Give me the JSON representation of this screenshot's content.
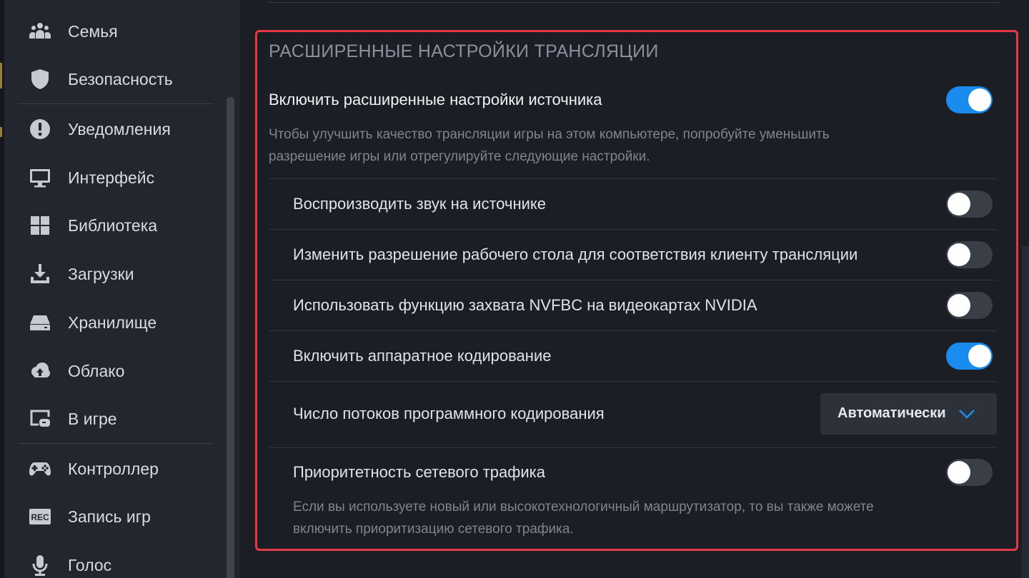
{
  "sidebar": {
    "items": [
      {
        "label": "Семья",
        "icon": "family-icon"
      },
      {
        "label": "Безопасность",
        "icon": "shield-icon"
      },
      {
        "label": "Уведомления",
        "icon": "alert-icon"
      },
      {
        "label": "Интерфейс",
        "icon": "monitor-icon"
      },
      {
        "label": "Библиотека",
        "icon": "grid-icon"
      },
      {
        "label": "Загрузки",
        "icon": "download-icon"
      },
      {
        "label": "Хранилище",
        "icon": "drive-icon"
      },
      {
        "label": "Облако",
        "icon": "cloud-icon"
      },
      {
        "label": "В игре",
        "icon": "ingame-icon"
      },
      {
        "label": "Контроллер",
        "icon": "gamepad-icon"
      },
      {
        "label": "Запись игр",
        "icon": "rec-icon"
      },
      {
        "label": "Голос",
        "icon": "microphone-icon"
      }
    ],
    "rec_badge": "REC"
  },
  "section": {
    "title": "РАСШИРЕННЫЕ НАСТРОЙКИ ТРАНСЛЯЦИИ",
    "main_toggle": {
      "label": "Включить расширенные настройки источника",
      "on": true,
      "description_line1": "Чтобы улучшить качество трансляции игры на этом компьютере, попробуйте уменьшить",
      "description_line2": "разрешение игры или отрегулируйте следующие настройки."
    },
    "rows": [
      {
        "label": "Воспроизводить звук на источнике",
        "on": false
      },
      {
        "label": "Изменить разрешение рабочего стола для соответствия клиенту трансляции",
        "on": false
      },
      {
        "label": "Использовать функцию захвата NVFBC на видеокартах NVIDIA",
        "on": false
      },
      {
        "label": "Включить аппаратное кодирование",
        "on": true
      }
    ],
    "threads": {
      "label": "Число потоков программного кодирования",
      "selected": "Автоматически"
    },
    "network": {
      "label": "Приоритетность сетевого трафика",
      "on": false,
      "description_line1": "Если вы используете новый или высокотехнологичный маршрутизатор, то вы также можете",
      "description_line2": "включить приоритизацию сетевого трафика."
    }
  },
  "colors": {
    "accent": "#1a8cf0",
    "highlight_border": "#e53a45",
    "sidebar_bg": "#23262e",
    "main_bg": "#1b1e25"
  }
}
